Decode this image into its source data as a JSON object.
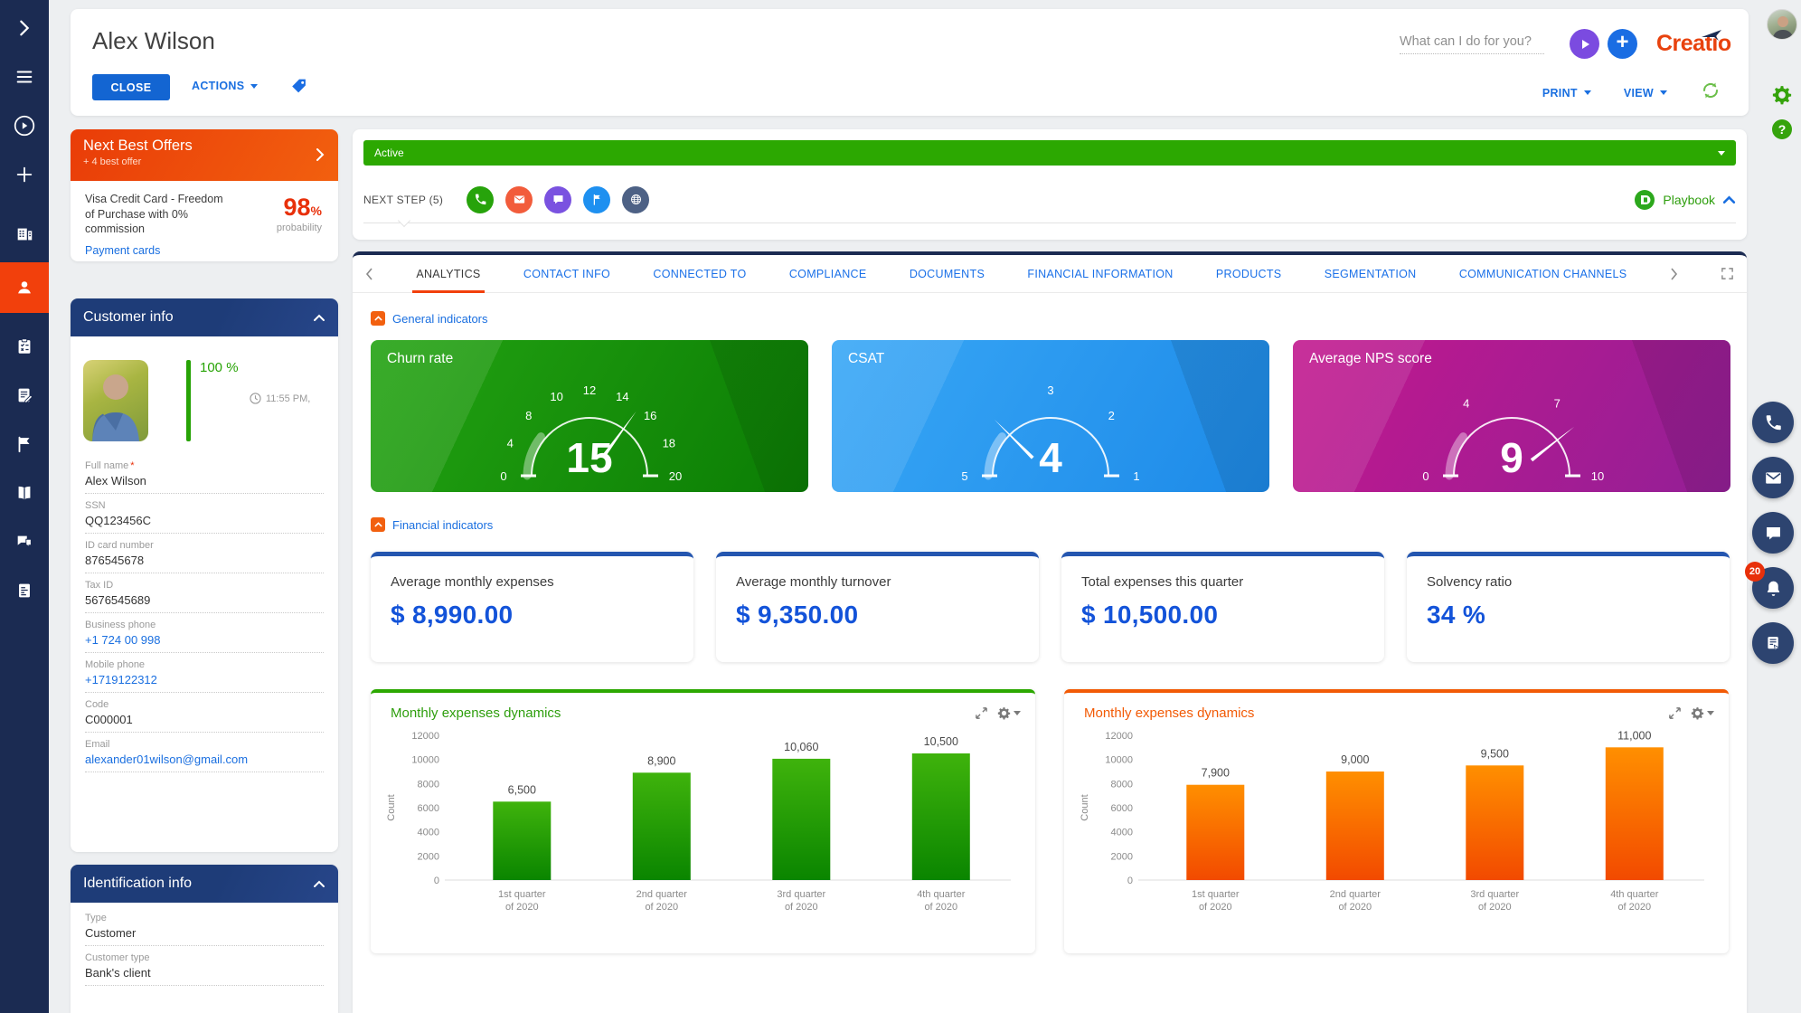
{
  "app": {
    "logo_text": "Creatio"
  },
  "header": {
    "title": "Alex Wilson",
    "close_label": "CLOSE",
    "actions_label": "ACTIONS",
    "assistant_placeholder": "What can I do for you?",
    "print_label": "PRINT",
    "view_label": "VIEW"
  },
  "offers": {
    "title": "Next Best Offers",
    "subtitle": "+ 4 best offer",
    "offer_text": "Visa Credit Card - Freedom of Purchase with 0% commission",
    "probability_value": "98",
    "probability_unit": "%",
    "probability_label": "probability",
    "link_label": "Payment cards"
  },
  "customer_info": {
    "title": "Customer info",
    "completeness": "100 %",
    "time": "11:55 PM,",
    "fields": [
      {
        "label": "Full name",
        "required": true,
        "value": "Alex Wilson",
        "link": false
      },
      {
        "label": "SSN",
        "required": false,
        "value": "QQ123456C",
        "link": false
      },
      {
        "label": "ID card number",
        "required": false,
        "value": "876545678",
        "link": false
      },
      {
        "label": "Tax ID",
        "required": false,
        "value": "5676545689",
        "link": false
      },
      {
        "label": "Business phone",
        "required": false,
        "value": "+1 724 00 998",
        "link": true
      },
      {
        "label": "Mobile phone",
        "required": false,
        "value": "+1719122312",
        "link": true
      },
      {
        "label": "Code",
        "required": false,
        "value": "C000001",
        "link": false
      },
      {
        "label": "Email",
        "required": false,
        "value": "alexander01wilson@gmail.com",
        "link": true
      }
    ]
  },
  "identification": {
    "title": "Identification info",
    "fields": [
      {
        "label": "Type",
        "required": false,
        "value": "Customer",
        "link": false
      },
      {
        "label": "Customer type",
        "required": false,
        "value": "Bank's client",
        "link": false
      }
    ]
  },
  "status": {
    "active_label": "Active",
    "next_step_label": "NEXT STEP (5)",
    "channel_icons": [
      "call-icon",
      "email-icon",
      "chat-icon",
      "flag-icon",
      "web-icon"
    ],
    "playbook_label": "Playbook"
  },
  "tabs": {
    "active_index": 0,
    "items": [
      "ANALYTICS",
      "CONTACT INFO",
      "CONNECTED TO",
      "COMPLIANCE",
      "DOCUMENTS",
      "FINANCIAL INFORMATION",
      "PRODUCTS",
      "SEGMENTATION",
      "COMMUNICATION CHANNELS"
    ]
  },
  "sections": {
    "general": "General indicators",
    "financial": "Financial indicators"
  },
  "notifications": {
    "badge": "20"
  },
  "colors": {
    "sidebar_navy": "#1b2b52",
    "accent_orange": "#f2400c",
    "link_blue": "#1a6fe0",
    "active_green": "#2ca801",
    "metric_blue": "#1353d9",
    "panel_navy": "#1e3c78"
  },
  "chart_data": [
    {
      "type": "gauge",
      "title": "Churn rate",
      "value": 15,
      "value_display": "15",
      "min": 0,
      "max": 20,
      "ticks": [
        {
          "label": "0",
          "deg": 180
        },
        {
          "label": "4",
          "deg": 157.5
        },
        {
          "label": "8",
          "deg": 135
        },
        {
          "label": "10",
          "deg": 112.5
        },
        {
          "label": "12",
          "deg": 90
        },
        {
          "label": "14",
          "deg": 67.5
        },
        {
          "label": "16",
          "deg": 45
        },
        {
          "label": "18",
          "deg": 22.5
        },
        {
          "label": "20",
          "deg": 0
        }
      ],
      "needle_deg": 54,
      "bg_from": "#23a312",
      "bg_to": "#0b7d04"
    },
    {
      "type": "gauge",
      "title": "CSAT",
      "value": 4,
      "value_display": "4",
      "min": 1,
      "max": 5,
      "ticks": [
        {
          "label": "5",
          "deg": 180
        },
        {
          "label": "3",
          "deg": 90
        },
        {
          "label": "2",
          "deg": 45
        },
        {
          "label": "1",
          "deg": 0
        }
      ],
      "needle_deg": 135,
      "bg_from": "#38a7f6",
      "bg_to": "#1d8ae8"
    },
    {
      "type": "gauge",
      "title": "Average NPS score",
      "value": 9,
      "value_display": "9",
      "min": 0,
      "max": 10,
      "ticks": [
        {
          "label": "0",
          "deg": 180
        },
        {
          "label": "4",
          "deg": 122
        },
        {
          "label": "7",
          "deg": 58
        },
        {
          "label": "10",
          "deg": 0
        }
      ],
      "needle_deg": 38,
      "bg_from": "#c2188e",
      "bg_to": "#931f96"
    },
    {
      "type": "metric",
      "label": "Average monthly expenses",
      "value_display": "$ 8,990.00"
    },
    {
      "type": "metric",
      "label": "Average monthly turnover",
      "value_display": "$ 9,350.00"
    },
    {
      "type": "metric",
      "label": "Total expenses this quarter",
      "value_display": "$ 10,500.00"
    },
    {
      "type": "metric",
      "label": "Solvency ratio",
      "value_display": "34 %"
    },
    {
      "type": "bar",
      "title": "Monthly expenses dynamics",
      "categories": [
        "1st quarter\nof 2020",
        "2nd quarter\nof 2020",
        "3rd quarter\nof 2020",
        "4th quarter\nof 2020"
      ],
      "values": [
        6500,
        8900,
        10060,
        10500
      ],
      "value_labels": [
        "6,500",
        "8,900",
        "10,060",
        "10,500"
      ],
      "ylabel": "Count",
      "ylim": [
        0,
        12000
      ],
      "yticks": [
        0,
        2000,
        4000,
        6000,
        8000,
        10000,
        12000
      ],
      "bar_from": "#3fb30c",
      "bar_to": "#0a8500"
    },
    {
      "type": "bar",
      "title": "Monthly expenses dynamics",
      "categories": [
        "1st quarter\nof 2020",
        "2nd quarter\nof 2020",
        "3rd quarter\nof 2020",
        "4th quarter\nof 2020"
      ],
      "values": [
        7900,
        9000,
        9500,
        11000
      ],
      "value_labels": [
        "7,900",
        "9,000",
        "9,500",
        "11,000"
      ],
      "ylabel": "Count",
      "ylim": [
        0,
        12000
      ],
      "yticks": [
        0,
        2000,
        4000,
        6000,
        8000,
        10000,
        12000
      ],
      "bar_from": "#ff8f00",
      "bar_to": "#f24a00"
    }
  ]
}
